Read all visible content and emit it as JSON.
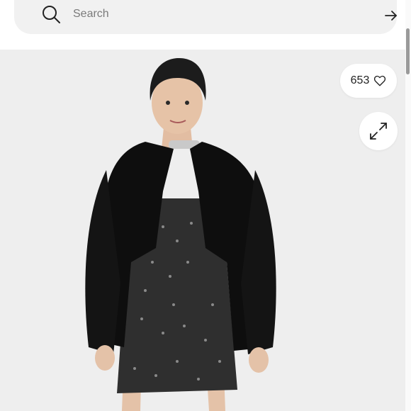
{
  "search": {
    "placeholder": "Search",
    "search_icon": "search-icon",
    "submit_icon": "arrow-right-icon"
  },
  "product": {
    "like_count": "653",
    "like_icon": "heart-outline-icon",
    "expand_icon": "expand-icon",
    "photo_description_icon": "product-photo"
  },
  "colors": {
    "search_bg": "#f1f1f1",
    "photo_bg": "#eeeeee",
    "jacket": "#0d0d0d",
    "dress_sequin": "#3a3a3a"
  }
}
